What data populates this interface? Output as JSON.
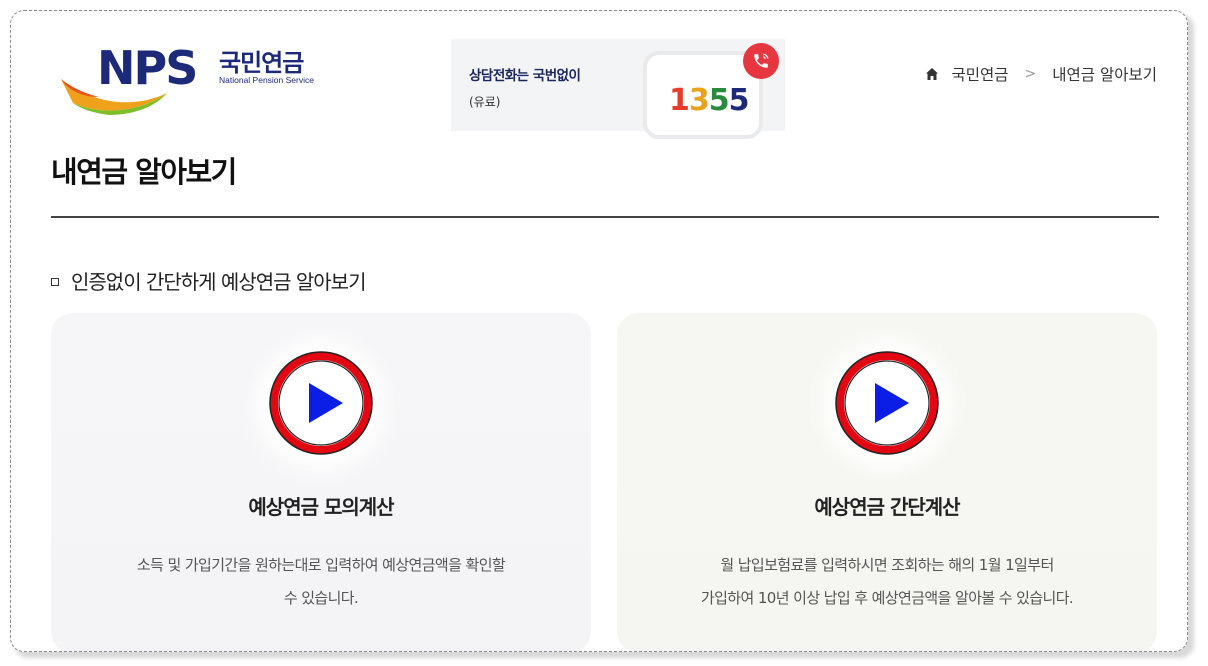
{
  "header": {
    "logo": {
      "mark": "NPS",
      "name_ko": "국민연금",
      "name_en": "National Pension Service"
    },
    "call_banner": {
      "title": "상담전화는 국번없이",
      "subtitle": "(유료)",
      "number_digits": [
        "1",
        "3",
        "5",
        "5"
      ],
      "icon": "phone-icon"
    },
    "breadcrumb": {
      "home_icon": "home-icon",
      "items": [
        "국민연금",
        "내연금 알아보기"
      ],
      "separator": ">"
    }
  },
  "page": {
    "title": "내연금 알아보기",
    "section_heading": "인증없이 간단하게 예상연금 알아보기"
  },
  "cards": [
    {
      "icon": "play-icon",
      "title": "예상연금 모의계산",
      "desc_line1": "소득 및 가입기간을 원하는대로 입력하여 예상연금액을 확인할",
      "desc_line2": "수 있습니다."
    },
    {
      "icon": "play-icon",
      "title": "예상연금 간단계산",
      "desc_line1": "월 납입보험료를 입력하시면 조회하는 해의 1월 1일부터",
      "desc_line2": "가입하여 10년 이상 납입 후 예상연금액을 알아볼 수 있습니다."
    }
  ],
  "colors": {
    "brand_navy": "#1d2a7a",
    "play_ring_red": "#e30613",
    "play_triangle_blue": "#0a1ee6",
    "phone_badge_red": "#e6363f"
  }
}
